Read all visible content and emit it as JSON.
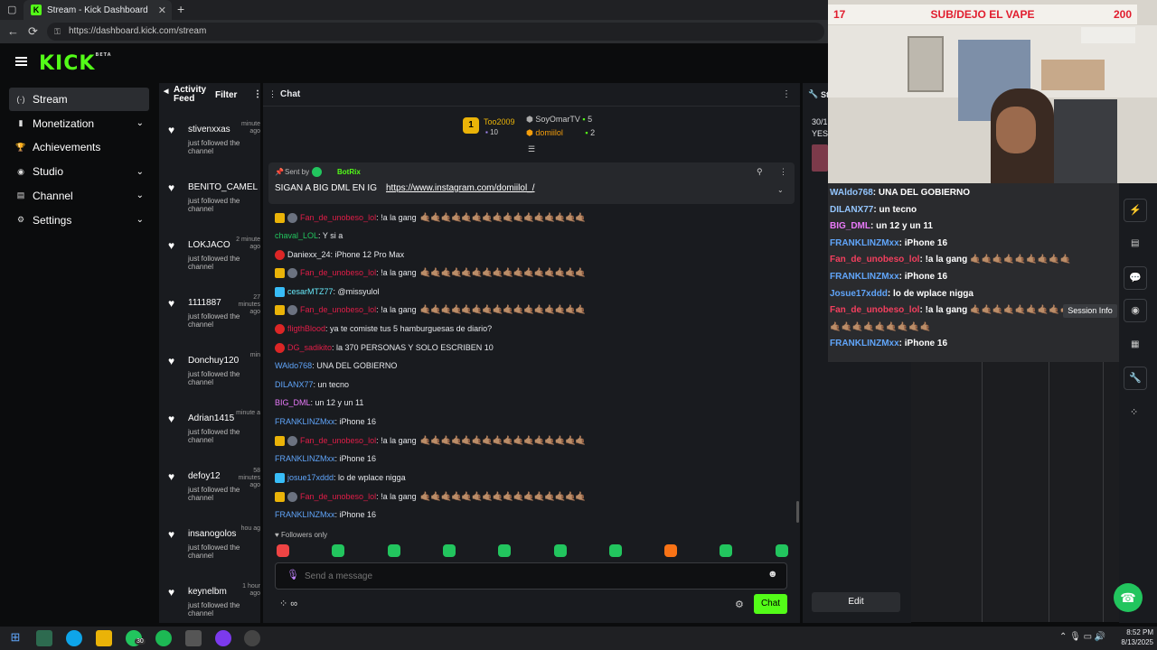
{
  "browser": {
    "tab_title": "Stream - Kick Dashboard",
    "url": "https://dashboard.kick.com/stream"
  },
  "brand": {
    "logo": "KICK",
    "beta": "BETA",
    "accent": "#53fc18"
  },
  "sidebar": [
    {
      "label": "Stream",
      "icon": "stream-icon",
      "active": true
    },
    {
      "label": "Monetization",
      "icon": "monetization-icon",
      "chevron": true
    },
    {
      "label": "Achievements",
      "icon": "achievements-icon"
    },
    {
      "label": "Studio",
      "icon": "studio-icon",
      "chevron": true
    },
    {
      "label": "Channel",
      "icon": "channel-icon",
      "chevron": true
    },
    {
      "label": "Settings",
      "icon": "settings-icon",
      "chevron": true
    }
  ],
  "activity": {
    "title": "Activity Feed",
    "filter": "Filter",
    "items": [
      {
        "name": "stivenxxas",
        "time": "minute ago",
        "desc": "just followed the channel"
      },
      {
        "name": "BENITO_CAMEL",
        "time": "",
        "desc": "just followed the channel"
      },
      {
        "name": "LOKJACO",
        "time": "2 minute ago",
        "desc": "just followed the channel"
      },
      {
        "name": "1111887",
        "time": "27 minutes ago",
        "desc": "just followed the channel"
      },
      {
        "name": "Donchuy120",
        "time": "min",
        "desc": "just followed the channel"
      },
      {
        "name": "Adrian1415",
        "time": "minute a",
        "desc": "just followed the channel"
      },
      {
        "name": "defoy12",
        "time": "58 minutes ago",
        "desc": "just followed the channel"
      },
      {
        "name": "insanogolos",
        "time": "hou ag",
        "desc": "just followed the channel"
      },
      {
        "name": "keynelbm",
        "time": "1 hour ago",
        "desc": "just followed the channel"
      }
    ]
  },
  "chat": {
    "title": "Chat",
    "leaders": {
      "rank": "1",
      "first": {
        "name": "Too2009",
        "count": "10"
      },
      "second": {
        "name": "SoyOmarTV",
        "count": "5"
      },
      "third": {
        "name": "domiilol",
        "count": "2"
      }
    },
    "pinned": {
      "sent_by": "Sent by",
      "bot": "BotRix",
      "text": "SIGAN A BIG DML EN IG",
      "link": "https://www.instagram.com/domiilol_/"
    },
    "messages": [
      {
        "user": "Fan_de_unobeso_lol",
        "color": "#e11d48",
        "text": ": !a la gang",
        "hands": true
      },
      {
        "user": "chaval_LOL",
        "color": "#22c55e",
        "text": ": Y si a"
      },
      {
        "user": "Daniexx_24",
        "color": "#e5e7eb",
        "text": ": iPhone 12 Pro Max"
      },
      {
        "user": "Fan_de_unobeso_lol",
        "color": "#e11d48",
        "text": ": !a la gang",
        "hands": true
      },
      {
        "user": "cesarMTZ77",
        "color": "#67e8f9",
        "text": ": @missyulol"
      },
      {
        "user": "Fan_de_unobeso_lol",
        "color": "#e11d48",
        "text": ": !a la gang",
        "hands": true
      },
      {
        "user": "fligthBlood",
        "color": "#e11d48",
        "text": ": ya te comiste tus 5 hamburguesas de diario?"
      },
      {
        "user": "DG_sadikito",
        "color": "#e11d48",
        "text": ": la 370 PERSONAS Y SOLO ESCRIBEN 10"
      },
      {
        "user": "WAldo768",
        "color": "#60a5fa",
        "text": ": UNA DEL GOBIERNO"
      },
      {
        "user": "DILANX77",
        "color": "#60a5fa",
        "text": ": un tecno"
      },
      {
        "user": "BIG_DML",
        "color": "#e879f9",
        "text": ": un 12 y un 11"
      },
      {
        "user": "FRANKLINZMxx",
        "color": "#60a5fa",
        "text": ": iPhone 16"
      },
      {
        "user": "Fan_de_unobeso_lol",
        "color": "#e11d48",
        "text": ": !a la gang",
        "hands": true
      },
      {
        "user": "FRANKLINZMxx",
        "color": "#60a5fa",
        "text": ": iPhone 16"
      },
      {
        "user": "josue17xddd",
        "color": "#60a5fa",
        "text": ": lo de wplace nigga"
      },
      {
        "user": "Fan_de_unobeso_lol",
        "color": "#e11d48",
        "text": ": !a la gang",
        "hands": true
      },
      {
        "user": "FRANKLINZMxx",
        "color": "#60a5fa",
        "text": ": iPhone 16"
      }
    ],
    "hands_text": "🤙🏽🤙🏽🤙🏽🤙🏽🤙🏽🤙🏽🤙🏽🤙🏽🤙🏽🤙🏽🤙🏽🤙🏽🤙🏽🤙🏽🤙🏽🤙🏽",
    "followers_only": "Followers only",
    "placeholder": "Send a message",
    "send": "Chat"
  },
  "stream_panel": {
    "title": "St",
    "line1": "30/1",
    "line2": "YES",
    "edit": "Edit"
  },
  "overlay": {
    "left_num": "17",
    "title": "SUB/DEJO EL VAPE",
    "right_num": "200",
    "messages": [
      {
        "user": "WAldo768",
        "color": "#93c5fd",
        "text": ": UNA DEL GOBIERNO"
      },
      {
        "user": "DILANX77",
        "color": "#93c5fd",
        "text": ": un tecno"
      },
      {
        "user": "BIG_DML",
        "color": "#e879f9",
        "text": ": un 12 y un 11"
      },
      {
        "user": "FRANKLINZMxx",
        "color": "#60a5fa",
        "text": ": iPhone 16"
      },
      {
        "user": "Fan_de_unobeso_lol",
        "color": "#f43f5e",
        "text": ": !a la gang 🤙🏽🤙🏽🤙🏽🤙🏽🤙🏽🤙🏽🤙🏽🤙🏽🤙🏽"
      },
      {
        "user": "FRANKLINZMxx",
        "color": "#60a5fa",
        "text": ": iPhone 16"
      },
      {
        "user": "Josue17xddd",
        "color": "#60a5fa",
        "text": ": lo de wplace nigga"
      },
      {
        "user": "Fan_de_unobeso_lol",
        "color": "#f43f5e",
        "text": ": !a la gang 🤙🏽🤙🏽🤙🏽🤙🏽🤙🏽🤙🏽🤙🏽🤙🏽🤙🏽"
      },
      {
        "user": "",
        "color": "#fff",
        "text": "🤙🏽🤙🏽🤙🏽🤙🏽🤙🏽🤙🏽🤙🏽🤙🏽🤙🏽"
      },
      {
        "user": "FRANKLINZMxx",
        "color": "#60a5fa",
        "text": ": iPhone 16"
      }
    ],
    "tooltip": "Session Info"
  },
  "taskbar": {
    "time": "8:52 PM",
    "date": "8/13/2025",
    "badge": "30"
  }
}
